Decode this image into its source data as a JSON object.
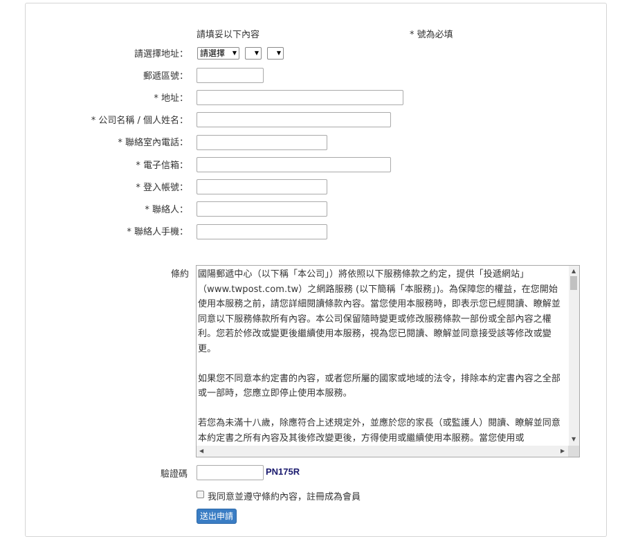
{
  "form": {
    "intro": "請填妥以下內容",
    "required_note": "* 號為必填",
    "fields": [
      {
        "label": "請選擇地址：",
        "value": ""
      },
      {
        "label": "郵遞區號：",
        "value": ""
      },
      {
        "label": "* 地址：",
        "value": ""
      },
      {
        "label": "* 公司名稱 / 個人姓名：",
        "value": ""
      },
      {
        "label": "* 聯絡室內電話：",
        "value": ""
      },
      {
        "label": "* 電子信箱：",
        "value": ""
      },
      {
        "label": "* 登入帳號：",
        "value": ""
      },
      {
        "label": "* 聯絡人：",
        "value": ""
      },
      {
        "label": "* 聯絡人手機：",
        "value": ""
      }
    ],
    "address_selects": [
      "請選擇",
      "",
      ""
    ],
    "terms_label": "條約",
    "terms_paragraphs": [
      "國陽郵遞中心（以下稱「本公司」）將依照以下服務條款之約定，提供「投遞網站」（www.twpost.com.tw）之網路服務 (以下簡稱「本服務」)。為保障您的權益，在您開始使用本服務之前，請您詳細閱讀條款內容。當您使用本服務時，即表示您已經閱讀、瞭解並同意以下服務條款所有內容。本公司保留隨時變更或修改服務條款一部份或全部內容之權利。您若於修改或變更後繼續使用本服務，視為您已閱讀、瞭解並同意接受該等修改或變更。",
      "如果您不同意本約定書的內容，或者您所屬的國家或地域的法令，排除本約定書內容之全部或一部時，您應立即停止使用本服務。",
      "若您為未滿十八歲，除應符合上述規定外，並應於您的家長（或監護人）閱讀、瞭解並同意本約定書之所有內容及其後修改變更後，方得使用或繼續使用本服務。當您使用或"
    ],
    "captcha_label": "驗證碼",
    "captcha_value": "",
    "captcha_code": "PN175R",
    "agree_label": "我同意並遵守條約內容，註冊成為會員",
    "submit_label": "送出申請"
  },
  "colors": {
    "captcha_code": "#1a1a6e",
    "submit_bg": "#3a7dc4"
  }
}
